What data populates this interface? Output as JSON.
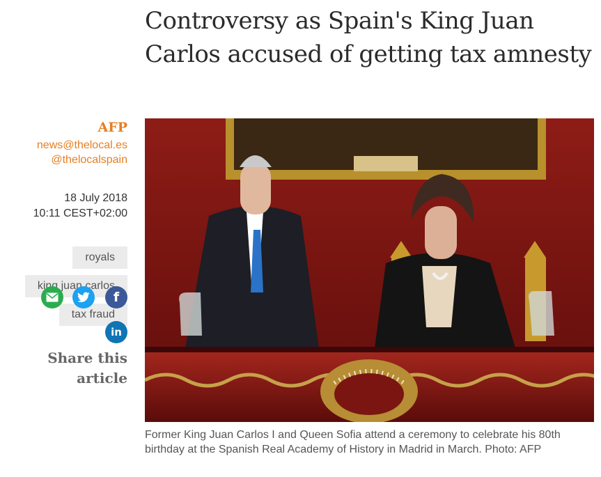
{
  "article": {
    "headline": "Controversy as Spain's King Juan Carlos accused of getting tax amnesty",
    "author": "AFP",
    "email": "news@thelocal.es",
    "twitter": "@thelocalspain",
    "date": "18 July 2018",
    "time": "10:11 CEST+02:00",
    "tags": [
      "royals",
      "king juan carlos",
      "tax fraud"
    ],
    "share_label": "Share this article",
    "share_buttons": [
      "email-icon",
      "twitter-icon",
      "facebook-icon",
      "linkedin-icon"
    ],
    "facebook_glyph": "f",
    "linkedin_glyph": "in",
    "caption": "Former King Juan Carlos I and Queen Sofia attend a ceremony to celebrate his 80th birthday at the Spanish Real Academy of History in Madrid in March. Photo: AFP"
  },
  "colors": {
    "accent": "#e67e22",
    "tag_bg": "#ebebeb",
    "email_share": "#2bad4f",
    "twitter_share": "#1da1f2",
    "facebook_share": "#3b5998",
    "linkedin_share": "#0f75b4"
  }
}
